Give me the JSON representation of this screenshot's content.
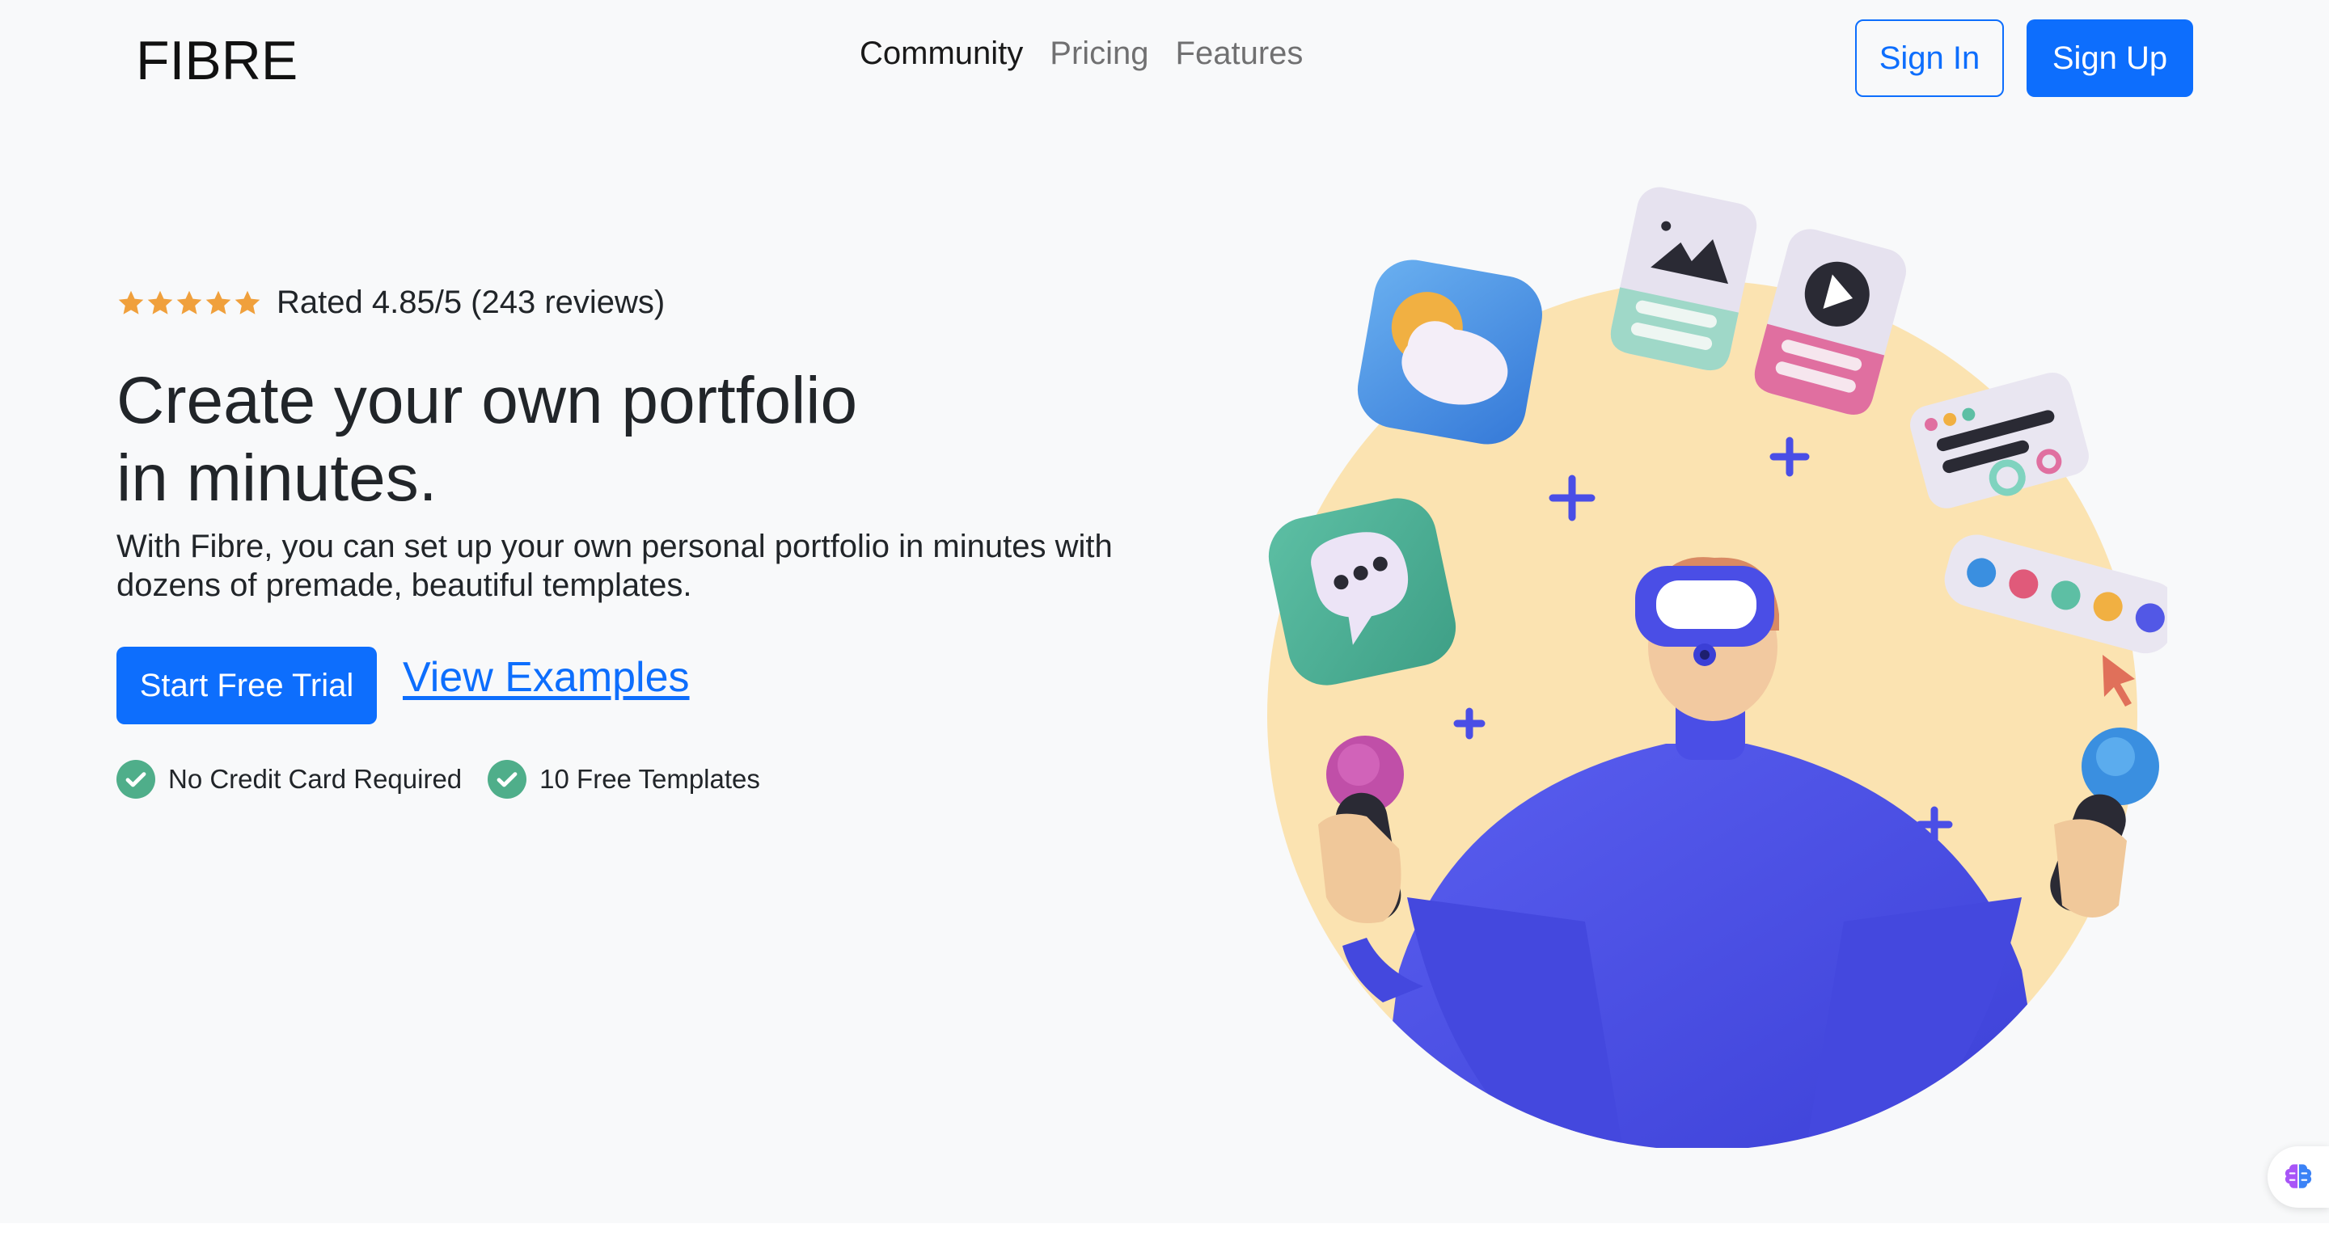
{
  "brand": {
    "logo": "FIBRE"
  },
  "nav": {
    "items": [
      {
        "label": "Community",
        "active": true
      },
      {
        "label": "Pricing",
        "active": false
      },
      {
        "label": "Features",
        "active": false
      }
    ]
  },
  "auth": {
    "signin_label": "Sign In",
    "signup_label": "Sign Up"
  },
  "hero": {
    "rating_stars": 5,
    "rating_text": "Rated 4.85/5 (243 reviews)",
    "headline_line1": "Create your own portfolio",
    "headline_line2": "in minutes.",
    "subtext": "With Fibre, you can set up your own personal portfolio in minutes with dozens of premade, beautiful templates.",
    "primary_cta": "Start Free Trial",
    "secondary_link": "View Examples",
    "checks": [
      {
        "label": "No Credit Card Required"
      },
      {
        "label": "10 Free Templates"
      }
    ]
  },
  "colors": {
    "primary": "#0d6efd",
    "star": "#f0a03c",
    "check": "#4fae8a",
    "circle_bg": "#fbe3b1",
    "figure": "#4a4ee6"
  },
  "icons": [
    "star-icon",
    "check-circle-icon",
    "brain-icon"
  ]
}
